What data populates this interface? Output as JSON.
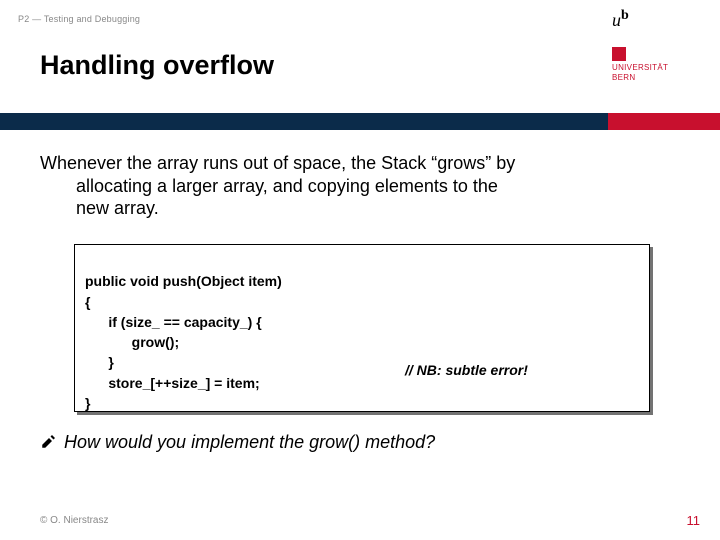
{
  "header": {
    "topic": "P2 — Testing and Debugging",
    "title": "Handling overflow",
    "logo": {
      "u": "u",
      "b": "b",
      "line1": "UNIVERSITÄT",
      "line2": "BERN"
    }
  },
  "body": {
    "para_line1": "Whenever the array runs out of space, the Stack “grows” by",
    "para_line2": "allocating a larger array, and copying elements to the",
    "para_line3": "new array."
  },
  "code": {
    "signature": "public void push(Object item)",
    "l1": "{",
    "l2": "      if (size_ == capacity_) {",
    "l3": "            grow();",
    "l4": "      }",
    "l5": "      store_[++size_] = item;",
    "l6": "}",
    "comment": "// NB: subtle error!"
  },
  "question": {
    "lead": "How",
    "rest": " would you implement the grow() method?"
  },
  "footer": {
    "copyright": "© O. Nierstrasz",
    "page": "11"
  }
}
